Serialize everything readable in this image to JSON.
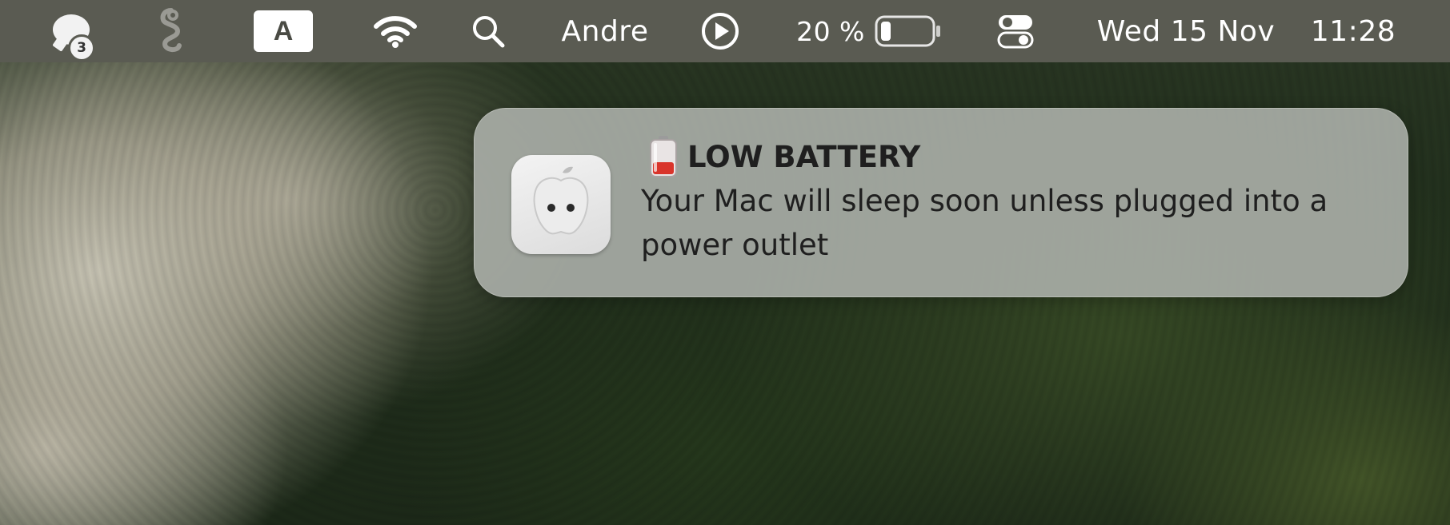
{
  "menubar": {
    "messages_badge": "3",
    "input_source": "A",
    "user_name": "Andre",
    "battery_percent": "20 %",
    "battery_level": 0.2,
    "date": "Wed 15 Nov",
    "time": "11:28",
    "icons": [
      "messages-icon",
      "g-app-icon",
      "input-source-icon",
      "wifi-icon",
      "search-icon",
      "play-icon",
      "battery-icon",
      "control-center-icon"
    ]
  },
  "notification": {
    "title": "LOW BATTERY",
    "body": "Your Mac will sleep soon unless plugged into a power outlet",
    "app_icon": "power-outlet-icon",
    "title_icon": "low-battery-icon",
    "accent_color": "#d9342b"
  }
}
